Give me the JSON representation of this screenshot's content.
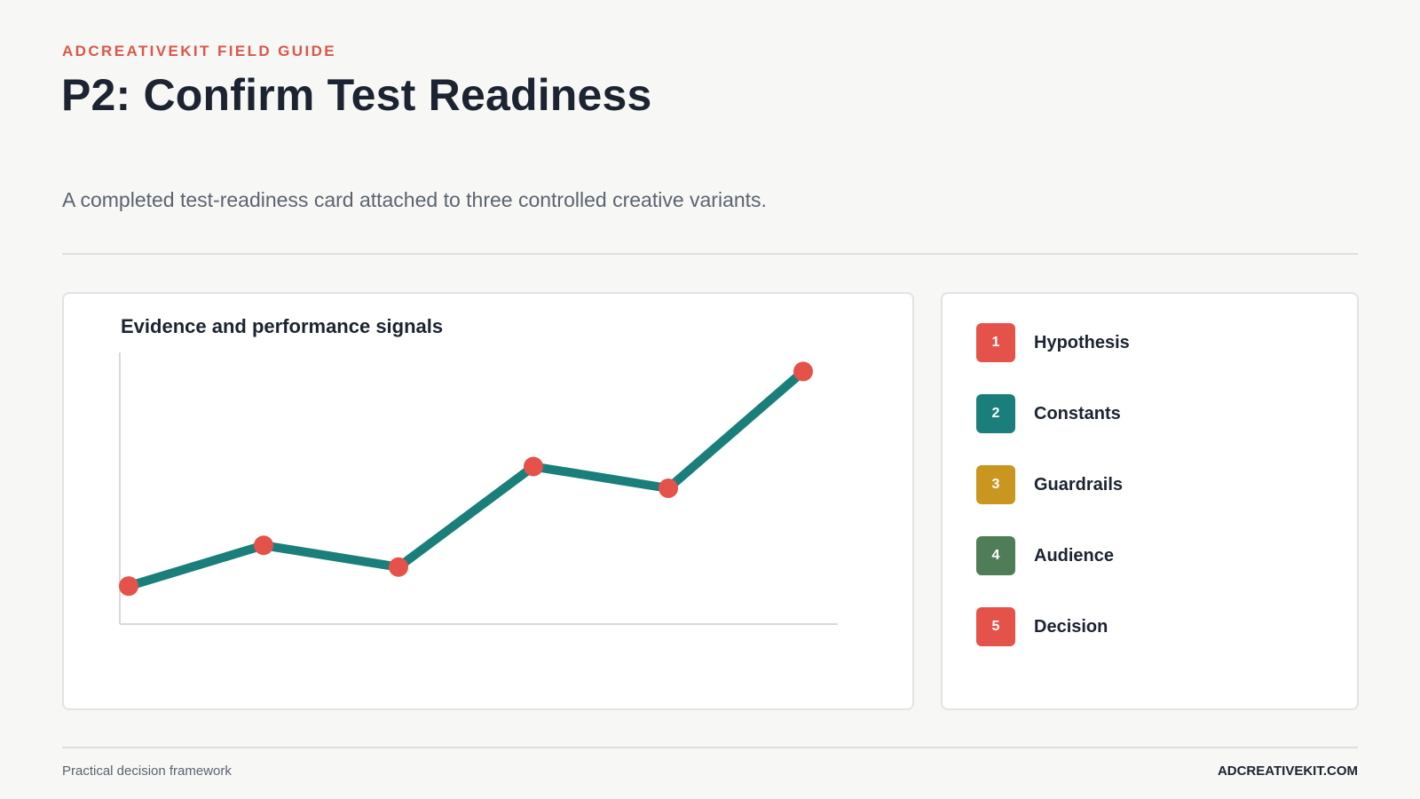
{
  "header": {
    "eyebrow": "ADCREATIVEKIT FIELD GUIDE",
    "title": "P2: Confirm Test Readiness",
    "subtitle": "A completed test-readiness card attached to three controlled creative variants."
  },
  "chart_data": {
    "type": "line",
    "title": "Evidence and performance signals",
    "xlabel": "",
    "ylabel": "",
    "x": [
      1,
      2,
      3,
      4,
      5,
      6
    ],
    "series": [
      {
        "values": [
          14,
          29,
          21,
          58,
          50,
          93
        ]
      }
    ],
    "ylim": [
      0,
      100
    ],
    "grid": false,
    "colors": {
      "line": "#1a7f7a",
      "marker": "#e5524a",
      "axis": "#d9d9d9"
    }
  },
  "legend": {
    "items": [
      {
        "number": "1",
        "label": "Hypothesis",
        "color": "#e5524a"
      },
      {
        "number": "2",
        "label": "Constants",
        "color": "#1a7f7a"
      },
      {
        "number": "3",
        "label": "Guardrails",
        "color": "#c9961f"
      },
      {
        "number": "4",
        "label": "Audience",
        "color": "#4f7d57"
      },
      {
        "number": "5",
        "label": "Decision",
        "color": "#e5524a"
      }
    ]
  },
  "footer": {
    "left": "Practical decision framework",
    "right": "ADCREATIVEKIT.COM"
  }
}
